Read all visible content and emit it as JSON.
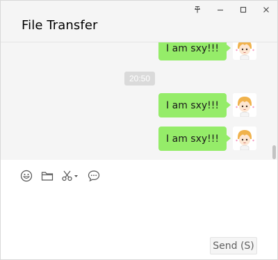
{
  "window": {
    "title": "File Transfer",
    "controls": {
      "pin_icon": "pin-icon",
      "minimize_icon": "minimize-icon",
      "maximize_icon": "maximize-icon",
      "close_icon": "close-icon"
    }
  },
  "chat": {
    "time_label": "20:50",
    "messages": [
      {
        "text": "I am sxy!!!",
        "sender": "self"
      },
      {
        "text": "I am sxy!!!",
        "sender": "self"
      },
      {
        "text": "I am sxy!!!",
        "sender": "self"
      }
    ]
  },
  "toolbar": {
    "icons": [
      "emoji-icon",
      "folder-icon",
      "screenshot-scissors-icon",
      "chat-history-icon"
    ]
  },
  "composer": {
    "value": "",
    "send_label": "Send (S)"
  },
  "colors": {
    "bubble": "#95ec69",
    "background": "#f5f5f5",
    "time_badge": "#dadada"
  }
}
